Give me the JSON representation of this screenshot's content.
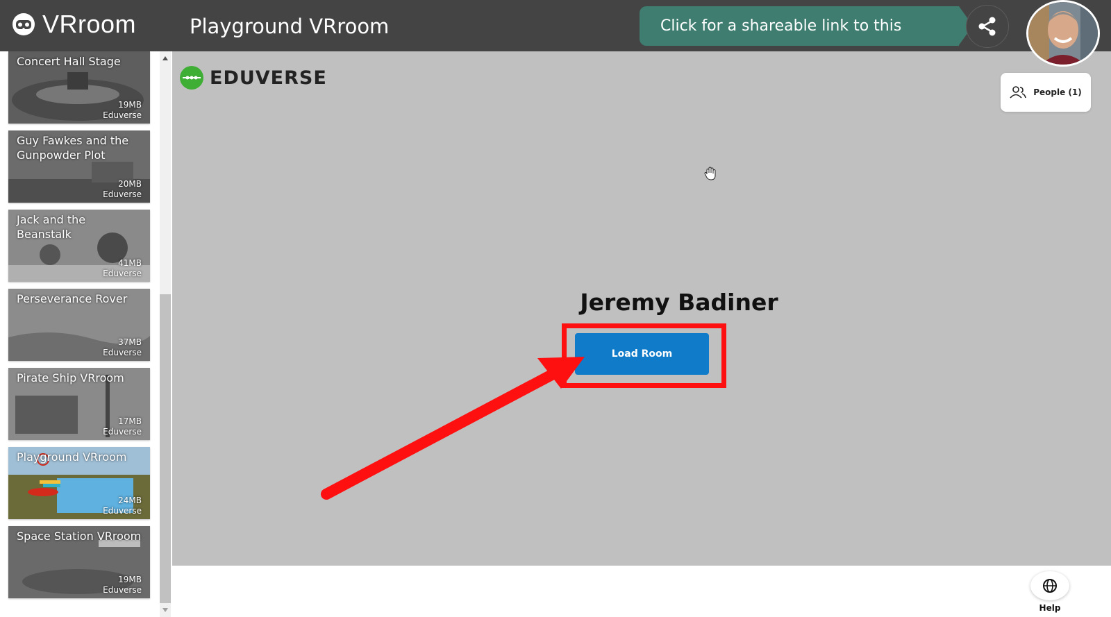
{
  "header": {
    "logo_text": "VRroom",
    "page_title": "Playground VRroom",
    "share_banner": "Click for a shareable link to this session",
    "share_icon": "share-icon",
    "avatar": "user-avatar"
  },
  "sidebar": {
    "rooms": [
      {
        "name": "Concert Hall Stage",
        "size": "19MB",
        "author": "Eduverse"
      },
      {
        "name": "Guy Fawkes and the Gunpowder Plot",
        "size": "20MB",
        "author": "Eduverse"
      },
      {
        "name": "Jack and the Beanstalk",
        "size": "41MB",
        "author": "Eduverse"
      },
      {
        "name": "Perseverance Rover",
        "size": "37MB",
        "author": "Eduverse"
      },
      {
        "name": "Pirate Ship VRroom",
        "size": "17MB",
        "author": "Eduverse"
      },
      {
        "name": "Playground VRroom",
        "size": "24MB",
        "author": "Eduverse"
      },
      {
        "name": "Space Station VRroom",
        "size": "19MB",
        "author": "Eduverse"
      }
    ]
  },
  "stage": {
    "brand": "EDUVERSE",
    "people_label": "People (1)",
    "user_name": "Jeremy Badiner",
    "load_room_label": "Load Room",
    "annotation_color": "#ff1010"
  },
  "footer": {
    "help_label": "Help"
  },
  "colors": {
    "topbar": "#444444",
    "share_banner": "#3e7d70",
    "stage_bg": "#c0c0c0",
    "button_blue": "#0f7bc9",
    "eduverse_green": "#3fae35"
  }
}
